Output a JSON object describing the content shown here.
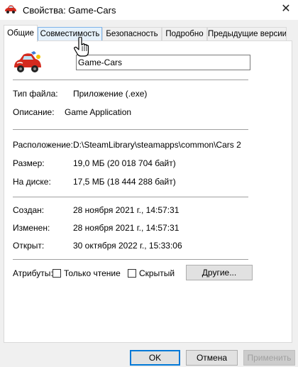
{
  "window": {
    "title": "Свойства: Game-Cars",
    "close_glyph": "✕"
  },
  "tabs": [
    {
      "label": "Общие",
      "active": true
    },
    {
      "label": "Совместимость",
      "active": false
    },
    {
      "label": "Безопасность",
      "active": false
    },
    {
      "label": "Подробно",
      "active": false
    },
    {
      "label": "Предыдущие версии",
      "active": false
    }
  ],
  "general": {
    "name_value": "Game-Cars",
    "file_type_label": "Тип файла:",
    "file_type_value": "Приложение (.exe)",
    "description_label": "Описание:",
    "description_value": "Game Application",
    "location_label": "Расположение:",
    "location_value": "D:\\SteamLibrary\\steamapps\\common\\Cars 2",
    "size_label": "Размер:",
    "size_value": "19,0 МБ (20 018 704 байт)",
    "disk_label": "На диске:",
    "disk_value": "17,5 МБ (18 444 288 байт)",
    "created_label": "Создан:",
    "created_value": "28 ноября 2021 г., 14:57:31",
    "modified_label": "Изменен:",
    "modified_value": "28 ноября 2021 г., 14:57:31",
    "accessed_label": "Открыт:",
    "accessed_value": "30 октября 2022 г., 15:33:06",
    "attributes_label": "Атрибуты:",
    "readonly_label": "Только чтение",
    "readonly_checked": false,
    "hidden_label": "Скрытый",
    "hidden_checked": false,
    "other_button": "Другие..."
  },
  "footer": {
    "ok": "OK",
    "cancel": "Отмена",
    "apply": "Применить"
  },
  "colors": {
    "accent": "#0078d7",
    "tab_hover": "#e5f1fb",
    "car_red": "#d42a1e"
  },
  "icons": {
    "app": "red-car-icon",
    "program": "red-car-icon",
    "cursor": "hand-pointer-cursor-icon"
  }
}
